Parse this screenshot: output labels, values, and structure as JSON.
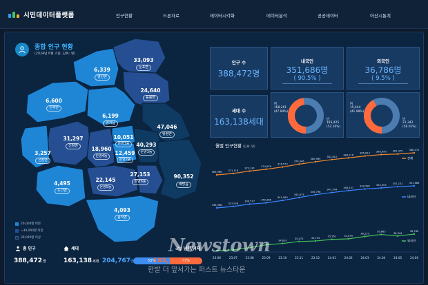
{
  "brand": {
    "name": "시민데이터플랫폼"
  },
  "nav": [
    "인구현황",
    "드론자료",
    "데이터시각화",
    "데이터분석",
    "공공데이터",
    "아산시통계"
  ],
  "panel": {
    "title": "종합 인구 현황",
    "subtitle": "(2024년 6월 기준, 단위: 명)"
  },
  "regions": [
    {
      "value": "33,093",
      "name": "둔포면",
      "level": 2
    },
    {
      "value": "6,339",
      "name": "영인면",
      "level": 1
    },
    {
      "value": "24,640",
      "name": "음봉면",
      "level": 2
    },
    {
      "value": "6,600",
      "name": "인주면",
      "level": 1
    },
    {
      "value": "6,199",
      "name": "염치읍",
      "level": 1
    },
    {
      "value": "47,046",
      "name": "탕정면",
      "level": 3
    },
    {
      "value": "31,297",
      "name": "신창면",
      "level": 2
    },
    {
      "value": "3,257",
      "name": "선장면",
      "level": 1
    },
    {
      "value": "10,051",
      "name": "온양1동",
      "level": 1
    },
    {
      "value": "18,960",
      "name": "온양4동",
      "level": 2
    },
    {
      "value": "12,459",
      "name": "온양2동",
      "level": 1
    },
    {
      "value": "40,293",
      "name": "온양3동",
      "level": 3
    },
    {
      "value": "4,495",
      "name": "도고면",
      "level": 1
    },
    {
      "value": "22,145",
      "name": "온양5동",
      "level": 2
    },
    {
      "value": "27,153",
      "name": "온양6동",
      "level": 2
    },
    {
      "value": "90,352",
      "name": "배방읍",
      "level": 3
    },
    {
      "value": "4,093",
      "name": "송악면",
      "level": 1
    }
  ],
  "legend": [
    "20,000명 미만",
    "~30,000명 미만",
    "30,000명 이상"
  ],
  "legend_colors": [
    "#1f86d6",
    "#254f92",
    "#0f3a62"
  ],
  "summary": {
    "pop_label": "총 인구",
    "pop_value": "388,472",
    "pop_unit": "명",
    "house_label": "세대",
    "house_value": "163,138",
    "house_unit": "세대"
  },
  "gender": {
    "label": "남자/여자",
    "male_value": "204,767",
    "male_unit": "명",
    "male_pct": "53%",
    "female_value": "183,705",
    "female_unit": "명",
    "female_pct": "47%"
  },
  "cards": {
    "population": {
      "title": "인구 수",
      "value": "388,472명"
    },
    "households": {
      "title": "세대 수",
      "value": "163,138세대"
    },
    "domestic": {
      "title": "내국인",
      "value": "351,686명",
      "pct": "( 90.5% )",
      "female_label": "여\n168,261\n(47.84%)",
      "male_label": "남\n183,425\n(52.16%)"
    },
    "foreign": {
      "title": "외국인",
      "value": "36,786명",
      "pct": "( 9.5% )",
      "female_label": "여\n15,444\n(41.98%)",
      "male_label": "남\n21,342\n(58.02%)"
    }
  },
  "chart_title": "월별 인구현황",
  "chart_unit": "(단위: 명)",
  "chart_data": {
    "type": "line",
    "title": "월별 인구현황",
    "categories": [
      "23.06",
      "23.07",
      "23.08",
      "23.09",
      "23.10",
      "23.11",
      "23.12",
      "24.01",
      "24.02",
      "24.03",
      "24.04",
      "24.05",
      "24.06"
    ],
    "series": [
      {
        "name": "전체",
        "color": "#f08a2a",
        "values": [
          369966,
          371118,
          373181,
          374676,
          376573,
          378946,
          380989,
          382810,
          384216,
          385814,
          386990,
          387475,
          388472
        ]
      },
      {
        "name": "내국인",
        "color": "#3a86ff",
        "values": [
          336988,
          337976,
          339517,
          340366,
          341963,
          343873,
          345796,
          347249,
          348537,
          349585,
          350305,
          351131,
          351686
        ]
      },
      {
        "name": "외국인",
        "color": "#43c15a",
        "values": [
          32978,
          33142,
          33664,
          34310,
          34610,
          35073,
          35193,
          35561,
          35679,
          36229,
          36685,
          36344,
          36786
        ]
      }
    ],
    "data_labels": [
      [
        "369,966",
        "371,118",
        "373,181",
        "374,676",
        "376,573",
        "378,946",
        "380,989",
        "382,810",
        "384,216",
        "385,814",
        "386,990",
        "387,475",
        "388,472"
      ],
      [
        "336,988",
        "337,976",
        "339,517",
        "340,366",
        "341,963",
        "343,873",
        "345,796",
        "347,249",
        "348,537",
        "349,585",
        "350,305",
        "351,131",
        "351,686"
      ],
      [
        "",
        "",
        "",
        "",
        "34,610",
        "35,073",
        "35,193",
        "35,561",
        "35,679",
        "36,229",
        "36,685",
        "36,344",
        "36,786"
      ]
    ]
  },
  "watermark": {
    "logo": "Newstown",
    "slogan": "한발 더 앞서가는 퍼스트 뉴스타운"
  }
}
